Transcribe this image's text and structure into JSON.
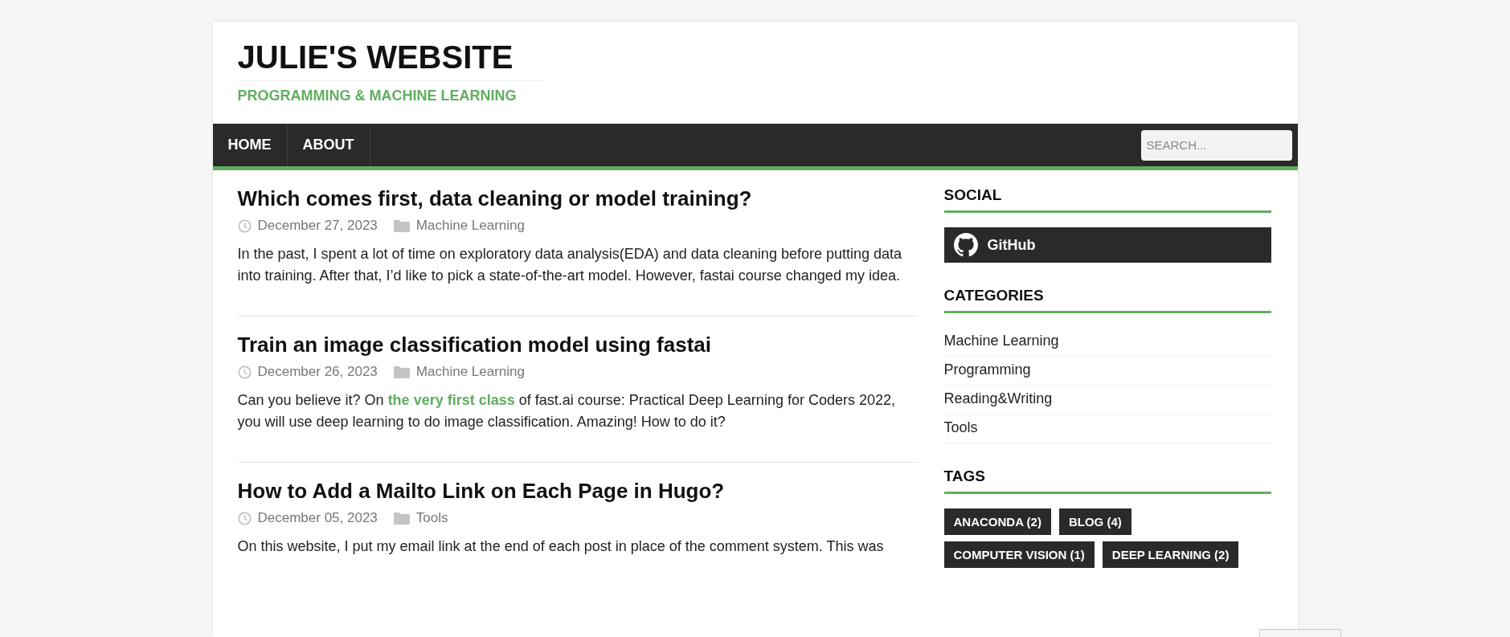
{
  "site": {
    "title": "JULIE'S WEBSITE",
    "tagline": "PROGRAMMING & MACHINE LEARNING"
  },
  "nav": {
    "items": [
      {
        "label": "HOME"
      },
      {
        "label": "ABOUT"
      }
    ],
    "search": {
      "placeholder": "SEARCH..."
    }
  },
  "posts": [
    {
      "title": "Which comes first, data cleaning or model training?",
      "date": "December 27, 2023",
      "category": "Machine Learning",
      "excerpt": [
        {
          "kind": "text",
          "text": "In the past, I spent a lot of time on exploratory data analysis(EDA) and data cleaning before putting data into training. After that, I’d like to pick a state-of-the-art model. However, fastai course changed my idea."
        }
      ]
    },
    {
      "title": "Train an image classification model using fastai",
      "date": "December 26, 2023",
      "category": "Machine Learning",
      "excerpt": [
        {
          "kind": "text",
          "text": "Can you believe it? On "
        },
        {
          "kind": "link",
          "text": "the very first class"
        },
        {
          "kind": "text",
          "text": " of fast.ai course: Practical Deep Learning for Coders 2022, you will use deep learning to do image classification. Amazing! How to do it?"
        }
      ]
    },
    {
      "title": "How to Add a Mailto Link on Each Page in Hugo?",
      "date": "December 05, 2023",
      "category": "Tools",
      "excerpt": [
        {
          "kind": "text",
          "text": "On this website, I put my email link at the end of each post in place of the comment system. This was"
        }
      ]
    }
  ],
  "sidebar": {
    "social": {
      "heading": "SOCIAL",
      "links": [
        {
          "label": "GitHub"
        }
      ]
    },
    "categories": {
      "heading": "CATEGORIES",
      "items": [
        "Machine Learning",
        "Programming",
        "Reading&Writing",
        "Tools"
      ]
    },
    "tags": {
      "heading": "TAGS",
      "items": [
        "ANACONDA (2)",
        "BLOG (4)",
        "COMPUTER VISION (1)",
        "DEEP LEARNING (2)"
      ]
    }
  }
}
